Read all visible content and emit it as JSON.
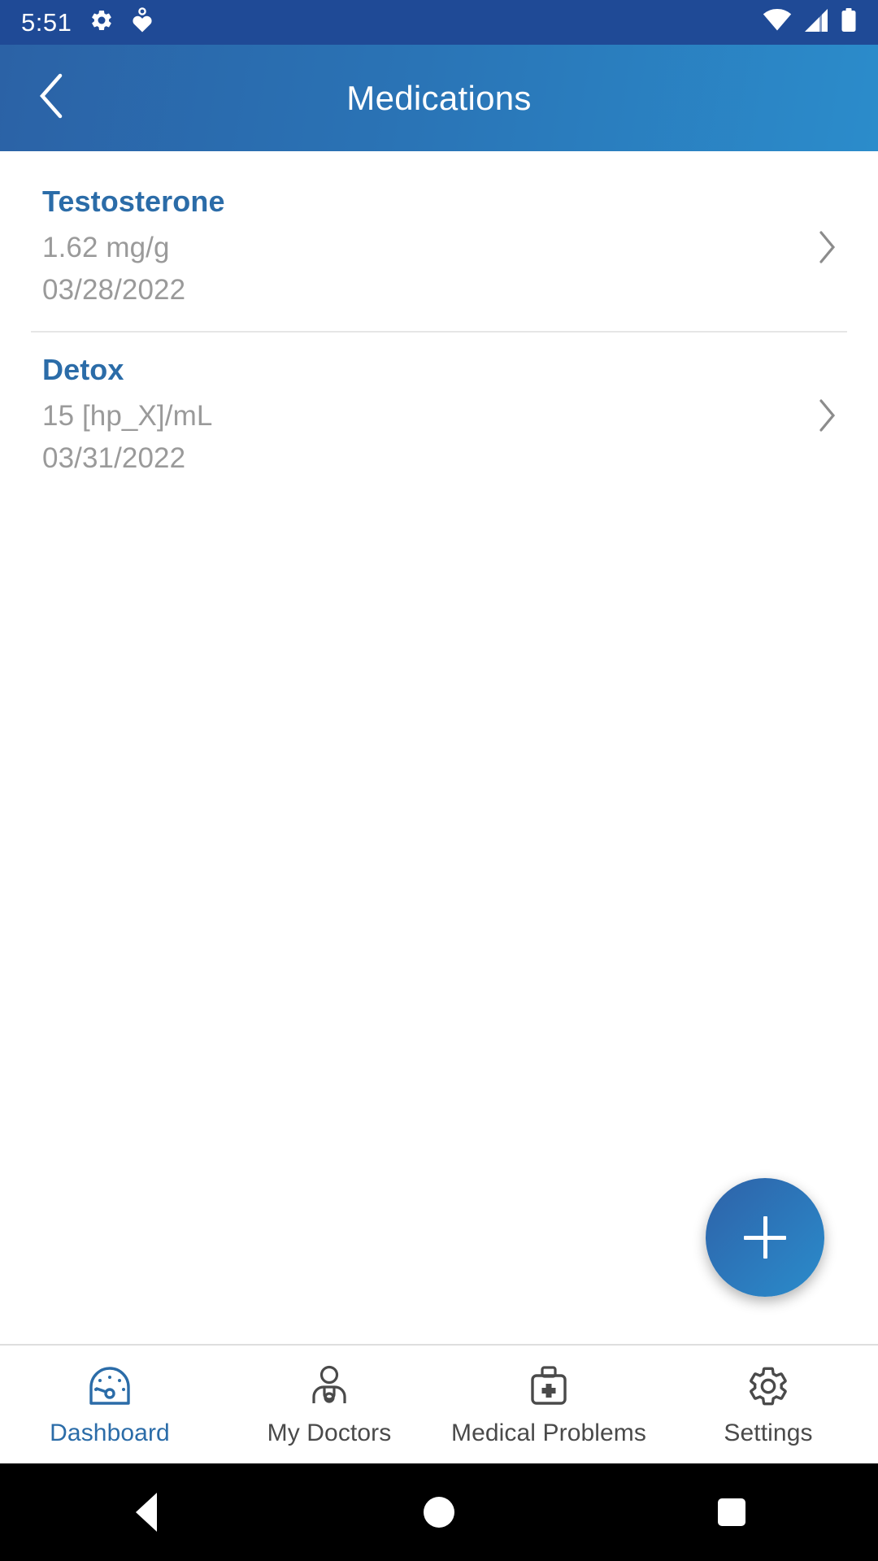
{
  "status_bar": {
    "time": "5:51",
    "left_icons": [
      "gear-icon",
      "heart-health-icon"
    ],
    "right_icons": [
      "wifi-icon",
      "cellular-signal-icon",
      "battery-icon"
    ],
    "background_color": "#1F4A96"
  },
  "app_bar": {
    "title": "Medications",
    "back_icon": "chevron-left-icon",
    "gradient_start": "#2B62A6",
    "gradient_end": "#2B8CCB"
  },
  "medications": [
    {
      "name": "Testosterone",
      "dose": "1.62 mg/g",
      "date": "03/28/2022",
      "chevron": "chevron-right-icon"
    },
    {
      "name": "Detox",
      "dose": "15 [hp_X]/mL",
      "date": "03/31/2022",
      "chevron": "chevron-right-icon"
    }
  ],
  "fab": {
    "label": "+",
    "icon": "plus-icon",
    "color": "#2C79BC"
  },
  "bottom_nav": {
    "active_index": 0,
    "active_color": "#2B6CA8",
    "inactive_color": "#4A4A4A",
    "tabs": [
      {
        "label": "Dashboard",
        "icon": "speedometer-icon"
      },
      {
        "label": "My Doctors",
        "icon": "doctor-icon"
      },
      {
        "label": "Medical Problems",
        "icon": "medical-kit-icon"
      },
      {
        "label": "Settings",
        "icon": "gear-icon"
      }
    ]
  },
  "system_nav": {
    "back": "back-triangle-icon",
    "home": "home-circle-icon",
    "recents": "recents-square-icon"
  }
}
